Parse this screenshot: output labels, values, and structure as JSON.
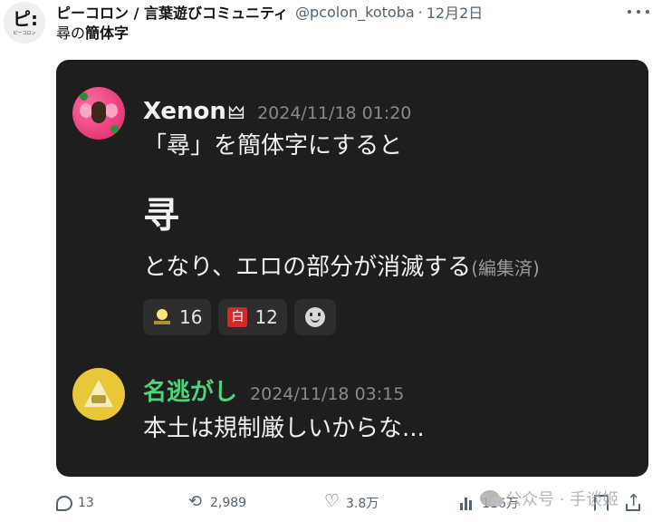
{
  "tweet": {
    "avatar_text": "ピ:",
    "avatar_subtext": "ピーコロン",
    "display_name": "ピーコロン / 言葉遊びコミュニティ",
    "handle": "@pcolon_kotoba",
    "separator": "·",
    "date": "12月2日",
    "text_prefix": "尋の",
    "text_bold": "簡体字"
  },
  "card": {
    "post1": {
      "name": "Xenon",
      "name_emoji": "🜲",
      "timestamp": "2024/11/18 01:20",
      "line1": "「尋」を簡体字にすると",
      "big_char": "寻",
      "line3": "となり、エロの部分が消滅する",
      "edited": "(編集済)",
      "reactions": [
        {
          "emoji": "lightbulb-desk-icon",
          "count": "16"
        },
        {
          "emoji": "white-stamp-icon",
          "count": "12"
        }
      ],
      "add_reaction_icon": "smiley-icon"
    },
    "post2": {
      "name": "名逃がし",
      "timestamp": "2024/11/18 03:15",
      "line1": "本土は規制厳しいからな..."
    }
  },
  "actions": {
    "replies": "13",
    "retweets": "2,989",
    "likes": "3.8万",
    "views": "116万"
  },
  "watermark": {
    "text": "公众号 · 手谈姬"
  },
  "colors": {
    "card_bg": "#1e1e1e",
    "green_name": "#4fd27a",
    "muted": "#536471"
  }
}
